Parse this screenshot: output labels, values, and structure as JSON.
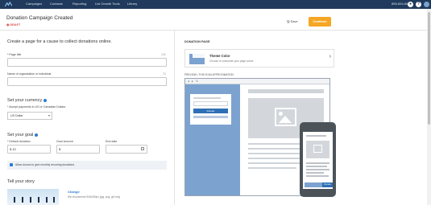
{
  "nav": {
    "links": [
      "Campaigns",
      "Contacts",
      "Reporting",
      "List Growth Tools",
      "Library"
    ],
    "phone": "855-654-6609"
  },
  "header": {
    "title": "Donation Campaign Created",
    "status": "DRAFT",
    "save_label": "Save",
    "continue_label": "Continue"
  },
  "form": {
    "lead": "Create a page for a cause to collect donations online.",
    "page_title_label": "* Page title",
    "page_title_counter": "100",
    "org_label": "Name of organization or individual",
    "org_counter": "70",
    "currency_heading": "Set your currency",
    "currency_label": "* Accept payments in US or Canadian Dollars",
    "currency_value": "US Dollar",
    "goal_heading": "Set your goal",
    "default_donation_label": "* Default donation",
    "default_donation_value": "$ 10",
    "goal_amount_label": "Goal amount",
    "goal_amount_value": "$",
    "end_date_label": "End date",
    "recurring_label": "Allow donors to give monthly recurring donations",
    "story_heading": "Tell your story",
    "change_label": "Change",
    "image_recommend": "We recommend 940x300px (jpg, png, gif only)"
  },
  "right": {
    "heading": "DONATION PAGE",
    "theme_title": "Theme Color",
    "theme_subtitle": "Choose or customize your page colors",
    "preview_label": "PREVIEW • THIS IS AN APPROXIMATION",
    "mini_donate": "Donate",
    "phone_donate": "Donate"
  },
  "colors": {
    "nav_bg": "#1f3a5c",
    "accent": "#f5a623",
    "theme": "#7ca2cf",
    "link": "#2b7bd6",
    "draft": "#d9534f"
  }
}
